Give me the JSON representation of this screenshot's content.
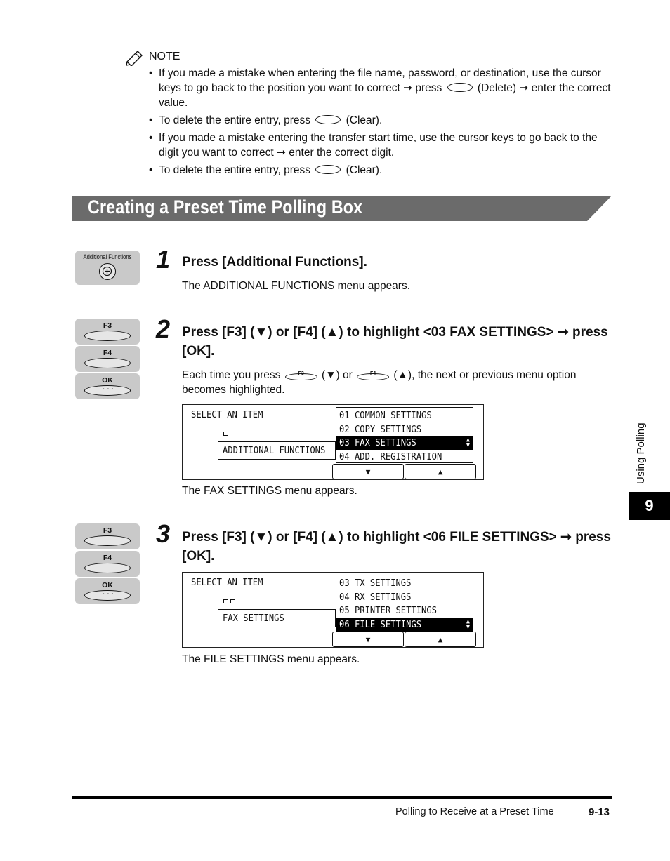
{
  "note": {
    "title": "NOTE",
    "items": [
      {
        "parts": [
          "If you made a mistake when entering the file name, password, or destination, use the cursor keys to go back to the position you want to correct ",
          "➞",
          " press ",
          "(Delete) ",
          "➞",
          " enter the correct value."
        ]
      },
      {
        "parts": [
          "To delete the entire entry, press ",
          "(Clear)."
        ]
      },
      {
        "parts": [
          "If you made a mistake entering the transfer start time, use the cursor keys to go back to the digit you want to correct ",
          "➞",
          " enter the correct digit."
        ]
      },
      {
        "parts": [
          "To delete the entire entry, press ",
          "(Clear)."
        ]
      }
    ]
  },
  "section": {
    "title": "Creating a Preset Time Polling Box"
  },
  "step1": {
    "number": "1",
    "panel_label": "Additional Functions",
    "title": "Press [Additional Functions].",
    "result": "The ADDITIONAL FUNCTIONS menu appears."
  },
  "step2": {
    "number": "2",
    "keys": [
      "F3",
      "F4",
      "OK"
    ],
    "title": "Press [F3] (▼) or [F4] (▲) to highlight <03 FAX SETTINGS> ➞ press [OK].",
    "body_a": "Each time you press ",
    "body_key1": "F3",
    "body_b": " (▼) or ",
    "body_key2": "F4",
    "body_c": " (▲), the next or previous menu option becomes highlighted.",
    "lcd": {
      "heading": "SELECT AN ITEM",
      "field": "ADDITIONAL FUNCTIONS",
      "items": [
        "01 COMMON SETTINGS",
        "02 COPY SETTINGS",
        "03 FAX SETTINGS",
        "04 ADD. REGISTRATION"
      ],
      "selected_index": 2
    },
    "result": "The FAX SETTINGS menu appears."
  },
  "step3": {
    "number": "3",
    "keys": [
      "F3",
      "F4",
      "OK"
    ],
    "title": "Press [F3] (▼) or [F4] (▲) to highlight <06 FILE SETTINGS> ➞ press [OK].",
    "lcd": {
      "heading": "SELECT AN ITEM",
      "field": "FAX SETTINGS",
      "items": [
        "03 TX SETTINGS",
        "04 RX SETTINGS",
        "05 PRINTER SETTINGS",
        "06 FILE SETTINGS"
      ],
      "selected_index": 3
    },
    "result": "The FILE SETTINGS menu appears."
  },
  "side_tab": {
    "text": "Using Polling",
    "chapter": "9"
  },
  "footer": {
    "text": "Polling to Receive at a Preset Time",
    "page": "9-13"
  },
  "lcd_buttons": {
    "down": "▼",
    "up": "▲"
  }
}
